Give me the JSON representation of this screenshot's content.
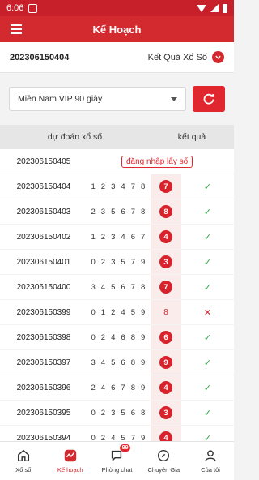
{
  "status": {
    "time": "6:06"
  },
  "app_bar": {
    "title": "Kế Hoạch"
  },
  "info": {
    "period": "202306150404",
    "result_link": "Kết Quả Xổ Số"
  },
  "select": {
    "value": "Miền Nam VIP 90 giây"
  },
  "table": {
    "col_prediction": "dự đoán xổ số",
    "col_result": "kết quả",
    "pending": {
      "period": "202306150405",
      "tag": "đăng nhập lấy số"
    },
    "rows": [
      {
        "period": "202306150404",
        "digits": "1 2 3 4 7 8",
        "result": "7",
        "outcome": "✓"
      },
      {
        "period": "202306150403",
        "digits": "2 3 5 6 7 8",
        "result": "8",
        "outcome": "✓"
      },
      {
        "period": "202306150402",
        "digits": "1 2 3 4 6 7",
        "result": "4",
        "outcome": "✓"
      },
      {
        "period": "202306150401",
        "digits": "0 2 3 5 7 9",
        "result": "3",
        "outcome": "✓"
      },
      {
        "period": "202306150400",
        "digits": "3 4 5 6 7 8",
        "result": "7",
        "outcome": "✓"
      },
      {
        "period": "202306150399",
        "digits": "0 1 2 4 5 9",
        "result": "8",
        "outcome": "✕"
      },
      {
        "period": "202306150398",
        "digits": "0 2 4 6 8 9",
        "result": "6",
        "outcome": "✓"
      },
      {
        "period": "202306150397",
        "digits": "3 4 5 6 8 9",
        "result": "9",
        "outcome": "✓"
      },
      {
        "period": "202306150396",
        "digits": "2 4 6 7 8 9",
        "result": "4",
        "outcome": "✓"
      },
      {
        "period": "202306150395",
        "digits": "0 2 3 5 6 8",
        "result": "3",
        "outcome": "✓"
      },
      {
        "period": "202306150394",
        "digits": "0 2 4 5 7 9",
        "result": "4",
        "outcome": "✓"
      }
    ]
  },
  "nav": {
    "items": [
      {
        "label": "Xổ số",
        "icon": "home-icon"
      },
      {
        "label": "Kế hoạch",
        "icon": "trend-icon"
      },
      {
        "label": "Phòng chat",
        "icon": "chat-icon",
        "badge": "99"
      },
      {
        "label": "Chuyên Gia",
        "icon": "compass-icon"
      },
      {
        "label": "Của tôi",
        "icon": "user-icon"
      }
    ]
  },
  "colors": {
    "brand": "#d32a2f",
    "ok": "#2ea043"
  }
}
